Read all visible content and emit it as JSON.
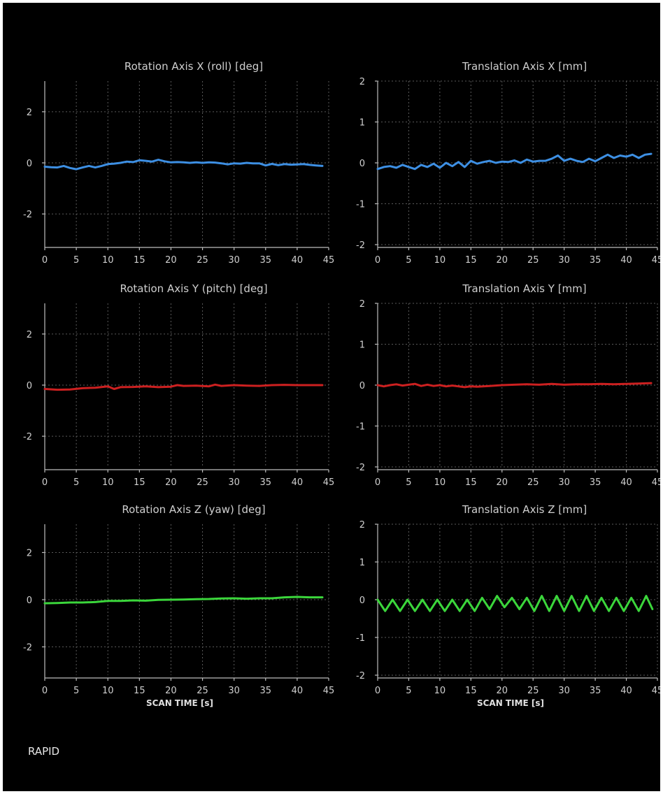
{
  "footer": {
    "label": "RAPID"
  },
  "colors": {
    "background": "#000000",
    "blue": "#3d8fe3",
    "red": "#cc2020",
    "green": "#3bd63b"
  },
  "chart_data": [
    {
      "type": "line",
      "title": "Rotation Axis X (roll) [deg]",
      "xlabel": "",
      "xlim": [
        0,
        45
      ],
      "ylim": [
        -3.2,
        3.2
      ],
      "xticks": [
        0,
        5,
        10,
        15,
        20,
        25,
        30,
        35,
        40,
        45
      ],
      "yticks": [
        -2,
        0,
        2
      ],
      "grid": true,
      "color": "#3d8fe3",
      "x": [
        0,
        1,
        2,
        3,
        4,
        5,
        6,
        7,
        8,
        9,
        10,
        11,
        12,
        13,
        14,
        15,
        16,
        17,
        18,
        19,
        20,
        21,
        22,
        23,
        24,
        25,
        26,
        27,
        28,
        29,
        30,
        31,
        32,
        33,
        34,
        35,
        36,
        37,
        38,
        39,
        40,
        41,
        42,
        43,
        44
      ],
      "y": [
        -0.15,
        -0.17,
        -0.18,
        -0.12,
        -0.2,
        -0.25,
        -0.18,
        -0.12,
        -0.18,
        -0.12,
        -0.05,
        -0.03,
        0.0,
        0.05,
        0.03,
        0.1,
        0.08,
        0.05,
        0.12,
        0.06,
        0.02,
        0.03,
        0.02,
        0.0,
        0.02,
        0.0,
        0.02,
        0.01,
        -0.02,
        -0.06,
        -0.02,
        -0.03,
        0.0,
        -0.02,
        -0.02,
        -0.1,
        -0.04,
        -0.09,
        -0.05,
        -0.07,
        -0.06,
        -0.05,
        -0.08,
        -0.1,
        -0.12
      ]
    },
    {
      "type": "line",
      "title": "Translation Axis X [mm]",
      "xlabel": "",
      "xlim": [
        0,
        45
      ],
      "ylim": [
        -2,
        2
      ],
      "xticks": [
        0,
        5,
        10,
        15,
        20,
        25,
        30,
        35,
        40,
        45
      ],
      "yticks": [
        -2,
        -1,
        0,
        1,
        2
      ],
      "grid": true,
      "color": "#3d8fe3",
      "x": [
        0,
        1,
        2,
        3,
        4,
        5,
        6,
        7,
        8,
        9,
        10,
        11,
        12,
        13,
        14,
        15,
        16,
        17,
        18,
        19,
        20,
        21,
        22,
        23,
        24,
        25,
        26,
        27,
        28,
        29,
        30,
        31,
        32,
        33,
        34,
        35,
        36,
        37,
        38,
        39,
        40,
        41,
        42,
        43,
        44
      ],
      "y": [
        -0.15,
        -0.1,
        -0.08,
        -0.12,
        -0.05,
        -0.1,
        -0.15,
        -0.05,
        -0.1,
        -0.02,
        -0.12,
        0.0,
        -0.08,
        0.02,
        -0.1,
        0.05,
        -0.02,
        0.02,
        0.05,
        0.0,
        0.03,
        0.02,
        0.06,
        0.0,
        0.08,
        0.03,
        0.05,
        0.05,
        0.1,
        0.18,
        0.05,
        0.1,
        0.05,
        0.02,
        0.1,
        0.04,
        0.12,
        0.2,
        0.12,
        0.18,
        0.15,
        0.2,
        0.12,
        0.2,
        0.22
      ]
    },
    {
      "type": "line",
      "title": "Rotation Axis Y (pitch) [deg]",
      "xlabel": "",
      "xlim": [
        0,
        45
      ],
      "ylim": [
        -3.2,
        3.2
      ],
      "xticks": [
        0,
        5,
        10,
        15,
        20,
        25,
        30,
        35,
        40,
        45
      ],
      "yticks": [
        -2,
        0,
        2
      ],
      "grid": true,
      "color": "#cc2020",
      "x": [
        0,
        2,
        4,
        6,
        8,
        10,
        11,
        12,
        14,
        16,
        18,
        20,
        21,
        22,
        24,
        26,
        27,
        28,
        30,
        32,
        34,
        36,
        38,
        40,
        42,
        44
      ],
      "y": [
        -0.15,
        -0.18,
        -0.17,
        -0.12,
        -0.1,
        -0.05,
        -0.15,
        -0.08,
        -0.07,
        -0.05,
        -0.08,
        -0.06,
        0.0,
        -0.03,
        -0.02,
        -0.05,
        0.02,
        -0.03,
        0.0,
        -0.02,
        -0.03,
        0.0,
        0.01,
        0.0,
        0.0,
        0.0
      ]
    },
    {
      "type": "line",
      "title": "Translation Axis Y [mm]",
      "xlabel": "",
      "xlim": [
        0,
        45
      ],
      "ylim": [
        -2,
        2
      ],
      "xticks": [
        0,
        5,
        10,
        15,
        20,
        25,
        30,
        35,
        40,
        45
      ],
      "yticks": [
        -2,
        -1,
        0,
        1,
        2
      ],
      "grid": true,
      "color": "#cc2020",
      "x": [
        0,
        1,
        2,
        3,
        4,
        5,
        6,
        7,
        8,
        9,
        10,
        11,
        12,
        13,
        14,
        15,
        16,
        17,
        18,
        20,
        22,
        24,
        26,
        28,
        30,
        32,
        34,
        36,
        38,
        40,
        42,
        44
      ],
      "y": [
        0.0,
        -0.03,
        0.0,
        0.02,
        -0.01,
        0.01,
        0.03,
        -0.02,
        0.01,
        -0.02,
        0.0,
        -0.03,
        -0.01,
        -0.03,
        -0.05,
        -0.03,
        -0.04,
        -0.03,
        -0.02,
        0.0,
        0.01,
        0.02,
        0.01,
        0.03,
        0.01,
        0.02,
        0.02,
        0.03,
        0.02,
        0.03,
        0.04,
        0.05
      ]
    },
    {
      "type": "line",
      "title": "Rotation Axis Z (yaw) [deg]",
      "xlabel": "SCAN TIME [s]",
      "xlim": [
        0,
        45
      ],
      "ylim": [
        -3.2,
        3.2
      ],
      "xticks": [
        0,
        5,
        10,
        15,
        20,
        25,
        30,
        35,
        40,
        45
      ],
      "yticks": [
        -2,
        0,
        2
      ],
      "grid": true,
      "color": "#3bd63b",
      "x": [
        0,
        2,
        4,
        6,
        8,
        10,
        12,
        14,
        16,
        18,
        20,
        22,
        24,
        26,
        28,
        30,
        32,
        34,
        36,
        38,
        40,
        42,
        44
      ],
      "y": [
        -0.15,
        -0.14,
        -0.12,
        -0.12,
        -0.1,
        -0.05,
        -0.05,
        -0.03,
        -0.04,
        -0.01,
        0.0,
        0.01,
        0.02,
        0.03,
        0.05,
        0.06,
        0.04,
        0.06,
        0.06,
        0.1,
        0.12,
        0.1,
        0.1
      ]
    },
    {
      "type": "line",
      "title": "Translation Axis Z [mm]",
      "xlabel": "SCAN TIME [s]",
      "xlim": [
        0,
        45
      ],
      "ylim": [
        -2,
        2
      ],
      "xticks": [
        0,
        5,
        10,
        15,
        20,
        25,
        30,
        35,
        40,
        45
      ],
      "yticks": [
        -2,
        -1,
        0,
        1,
        2
      ],
      "grid": true,
      "color": "#3bd63b",
      "x": [
        0,
        1.2,
        2.4,
        3.6,
        4.8,
        6.0,
        7.2,
        8.4,
        9.6,
        10.8,
        12.0,
        13.2,
        14.4,
        15.6,
        16.8,
        18.0,
        19.2,
        20.4,
        21.6,
        22.8,
        24.0,
        25.2,
        26.4,
        27.6,
        28.8,
        30.0,
        31.2,
        32.4,
        33.6,
        34.8,
        36.0,
        37.2,
        38.4,
        39.6,
        40.8,
        42.0,
        43.2,
        44.2
      ],
      "y": [
        0.0,
        -0.3,
        0.0,
        -0.3,
        0.0,
        -0.3,
        0.0,
        -0.3,
        0.0,
        -0.3,
        0.0,
        -0.3,
        0.0,
        -0.3,
        0.05,
        -0.25,
        0.1,
        -0.2,
        0.05,
        -0.25,
        0.05,
        -0.3,
        0.1,
        -0.3,
        0.1,
        -0.3,
        0.1,
        -0.3,
        0.1,
        -0.3,
        0.05,
        -0.3,
        0.05,
        -0.3,
        0.05,
        -0.3,
        0.1,
        -0.25
      ]
    }
  ]
}
